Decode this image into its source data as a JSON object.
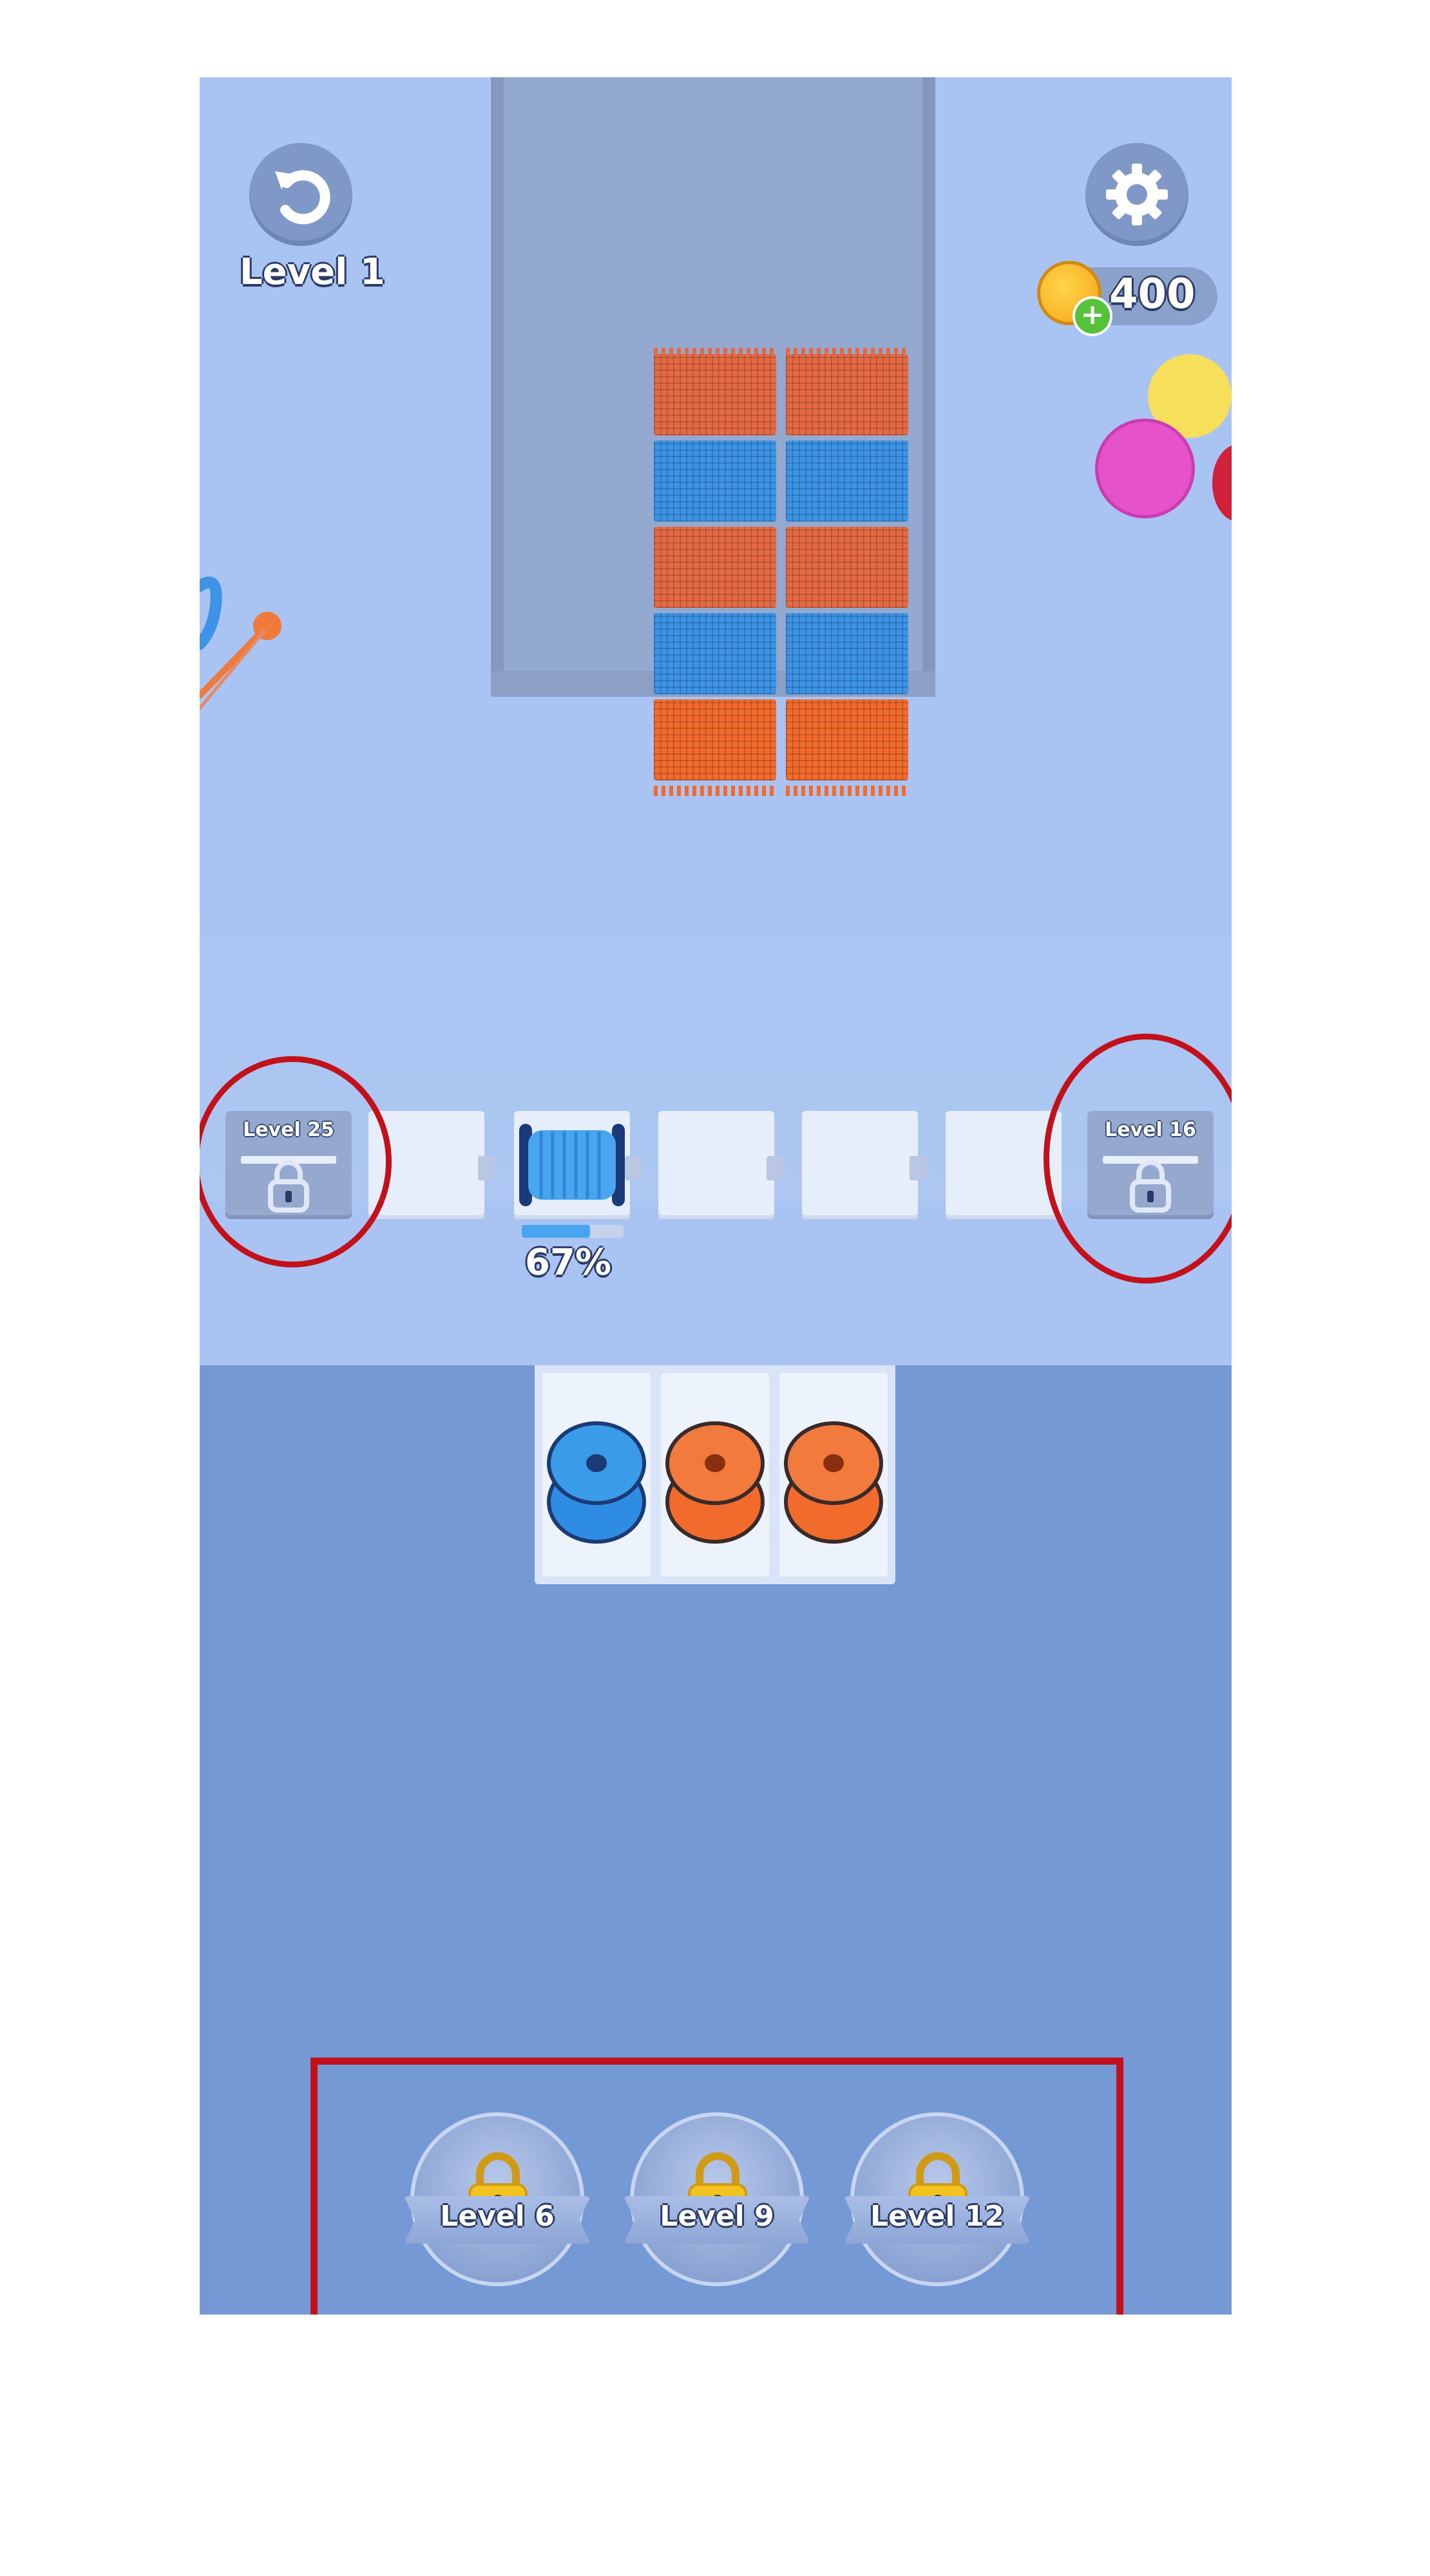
{
  "hud": {
    "undo_icon": "undo-arrow-icon",
    "settings_icon": "gear-icon",
    "level_label": "Level 1",
    "coins": "400",
    "coin_icon": "coin-icon",
    "add_coins_icon": "plus-icon"
  },
  "fabric_bin": {
    "columns": 2,
    "stripe_colors": [
      "#e56a43",
      "#3d93e6",
      "#e56a43",
      "#3d93e6",
      "#f26a2c"
    ]
  },
  "conveyor": {
    "left_lock_label": "Level 25",
    "right_lock_label": "Level 16",
    "active_spool_color": "#49a5f0",
    "progress_percent": 67,
    "progress_text": "67%",
    "lock_icon": "padlock-icon"
  },
  "spool_tray": {
    "spools": [
      {
        "color": "#2e8de2",
        "stack": 2
      },
      {
        "color": "#f06b2c",
        "stack": 2
      },
      {
        "color": "#f06b2c",
        "stack": 2
      }
    ]
  },
  "boosters": [
    {
      "label": "Level 6",
      "icon": "gold-padlock-icon"
    },
    {
      "label": "Level 9",
      "icon": "gold-padlock-icon"
    },
    {
      "label": "Level 12",
      "icon": "gold-padlock-icon"
    }
  ],
  "colors": {
    "annotation_red": "#c3111b",
    "background_top": "#a9c4f2",
    "background_bottom": "#7599d5"
  }
}
